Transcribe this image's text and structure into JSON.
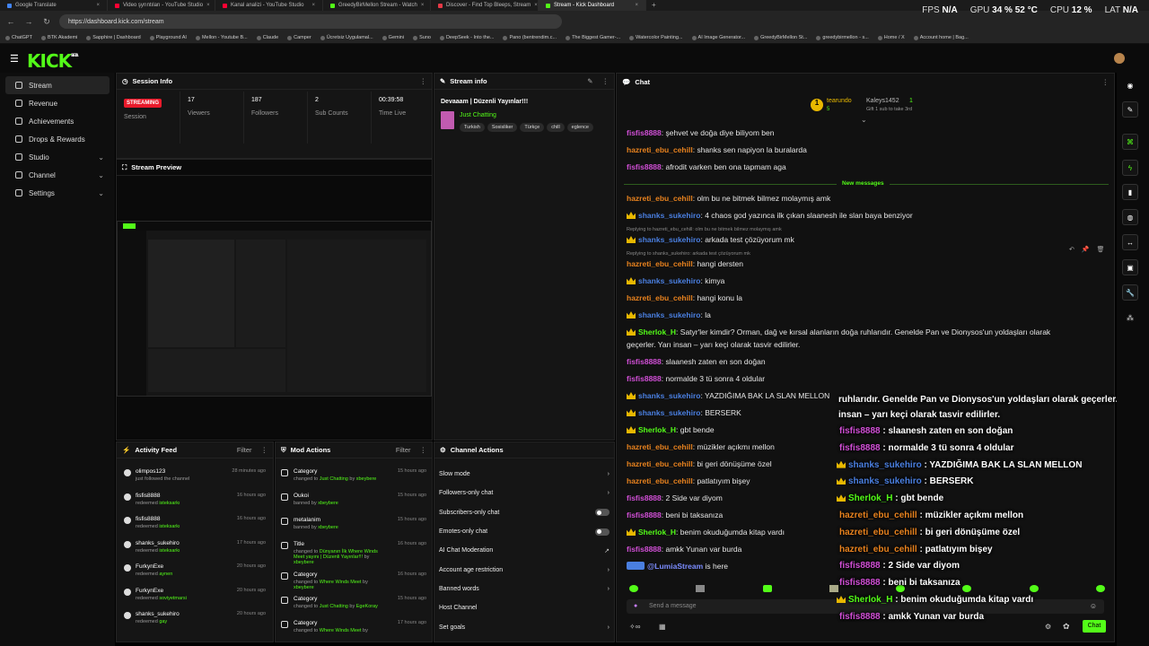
{
  "tabs": [
    {
      "label": "Google Translate",
      "color": "#4285f4"
    },
    {
      "label": "Video şyrıntıları - YouTube Studio",
      "color": "#ff0033"
    },
    {
      "label": "Kanal analizi - YouTube Studio",
      "color": "#ff0033"
    },
    {
      "label": "GreedyBirMellon Stream - Watch",
      "color": "#53fc18"
    },
    {
      "label": "Discover - Find Top Bleeps, Stream",
      "color": "#e63946"
    },
    {
      "label": "Stream - Kick Dashboard",
      "color": "#53fc18"
    }
  ],
  "new_tab": "+",
  "url": "https://dashboard.kick.com/stream",
  "hud": {
    "fps_label": "FPS",
    "fps": "N/A",
    "gpu_label": "GPU",
    "gpu": "34 % 52 °C",
    "cpu_label": "CPU",
    "cpu": "12 %",
    "lat_label": "LAT",
    "lat": "N/A"
  },
  "bookmarks": [
    "ChatGPT",
    "BTK Akademi",
    "Sapphire | Dashboard",
    "Playground AI",
    "Mellon - Youtube B...",
    "Claude",
    "Camper",
    "Ücretsiz Uygulamal...",
    "Gemini",
    "Suno",
    "DeepSeek - Into the...",
    "Pano (bentrendim.c...",
    "The Biggest Gamer-...",
    "Watercolor Painting...",
    "AI Image Generator...",
    "GreedyBirMellon St...",
    "greedybirmellon - s...",
    "Home / X",
    "Account home | Bag..."
  ],
  "logo": "KICK",
  "logo_sup": "BETA",
  "sidebar": [
    {
      "label": "Stream"
    },
    {
      "label": "Revenue"
    },
    {
      "label": "Achievements"
    },
    {
      "label": "Drops & Rewards"
    },
    {
      "label": "Studio"
    },
    {
      "label": "Channel"
    },
    {
      "label": "Settings"
    }
  ],
  "session": {
    "title": "Session Info",
    "status": "STREAMING",
    "status_label": "Session",
    "viewers": "17",
    "viewers_label": "Viewers",
    "followers": "187",
    "followers_label": "Followers",
    "subs": "2",
    "subs_label": "Sub Counts",
    "time": "00:39:58",
    "time_label": "Time Live"
  },
  "stream_info": {
    "title": "Stream info",
    "stream_title": "Devaaam | Düzenli Yayınlar!!!",
    "category": "Just Chatting",
    "tags": [
      "Turkish",
      "Sosisliker",
      "Türkçe",
      "chill",
      "eglence"
    ]
  },
  "preview": {
    "title": "Stream Preview"
  },
  "activity": {
    "title": "Activity Feed",
    "filter": "Filter",
    "items": [
      {
        "user": "olimpos123",
        "detail": "just followed the channel",
        "reward": "",
        "time": "28 minutes ago"
      },
      {
        "user": "fisfis8888",
        "detail": "redeemed",
        "reward": "isteksarkı",
        "time": "16 hours ago"
      },
      {
        "user": "fisfis8888",
        "detail": "redeemed",
        "reward": "isteksarkı",
        "time": "16 hours ago"
      },
      {
        "user": "shanks_sukehiro",
        "detail": "redeemed",
        "reward": "isteksarkı",
        "time": "17 hours ago"
      },
      {
        "user": "FurkynExe",
        "detail": "redeemed",
        "reward": "aynen",
        "time": "20 hours ago"
      },
      {
        "user": "FurkynExe",
        "detail": "redeemed",
        "reward": "soviyetmarsi",
        "time": "20 hours ago"
      },
      {
        "user": "shanks_sukehiro",
        "detail": "redeemed",
        "reward": "gay",
        "time": "20 hours ago"
      }
    ]
  },
  "mod": {
    "title": "Mod Actions",
    "filter": "Filter",
    "items": [
      {
        "title": "Category",
        "line": "changed to",
        "value": "Just Chatting",
        "by": "by",
        "mod": "xbeybere",
        "time": "15 hours ago"
      },
      {
        "title": "Oukoi",
        "line": "banned by",
        "value": "",
        "by": "",
        "mod": "xbeybere",
        "time": "15 hours ago"
      },
      {
        "title": "metalanim",
        "line": "banned by",
        "value": "",
        "by": "",
        "mod": "xbeybere",
        "time": "15 hours ago"
      },
      {
        "title": "Title",
        "line": "changed to",
        "value": "Dünyanın İlk Where Winds Meet yayını | Düzenli Yayınlar!!!",
        "by": "by",
        "mod": "xbeybere",
        "time": "16 hours ago"
      },
      {
        "title": "Category",
        "line": "changed to",
        "value": "Where Winds Meet",
        "by": "by",
        "mod": "xbeybere",
        "time": "16 hours ago"
      },
      {
        "title": "Category",
        "line": "changed to",
        "value": "Just Chatting",
        "by": "by",
        "mod": "EgeKoray",
        "time": "15 hours ago"
      },
      {
        "title": "Category",
        "line": "changed to",
        "value": "Where Winds Meet",
        "by": "by",
        "mod": "",
        "time": "17 hours ago"
      }
    ]
  },
  "channel_actions": {
    "title": "Channel Actions",
    "items": [
      {
        "label": "Slow mode",
        "ctl": "›"
      },
      {
        "label": "Followers-only chat",
        "ctl": "›"
      },
      {
        "label": "Subscribers-only chat",
        "ctl": "toggle"
      },
      {
        "label": "Emotes-only chat",
        "ctl": "toggle"
      },
      {
        "label": "AI Chat Moderation",
        "ctl": "↗"
      },
      {
        "label": "Account age restriction",
        "ctl": "›"
      },
      {
        "label": "Banned words",
        "ctl": "›"
      },
      {
        "label": "Host Channel",
        "ctl": ""
      },
      {
        "label": "Set goals",
        "ctl": "›"
      }
    ]
  },
  "chat": {
    "title": "Chat",
    "pinned": {
      "user": "tearundo",
      "level": "5",
      "gifter": "Kaleys1452",
      "count": "1",
      "note": "Gift 1 sub to take 3rd"
    },
    "new_messages": "New messages",
    "placeholder": "Send a message",
    "send": "Chat",
    "messages": [
      {
        "user": "fisfis8888",
        "color": "#d14fd6",
        "text": "şehvet ve doğa diye biliyom ben",
        "crown": false
      },
      {
        "user": "hazreti_ebu_cehill",
        "color": "#e8821e",
        "text": "shanks sen napiyon la buralarda",
        "crown": false
      },
      {
        "user": "fisfis8888",
        "color": "#d14fd6",
        "text": "afrodit varken ben ona tapmam aga",
        "crown": false
      },
      {
        "user": "hazreti_ebu_cehill",
        "color": "#e8821e",
        "text": "olm bu ne bitmek bilmez molaymış amk",
        "crown": false
      },
      {
        "user": "shanks_sukehiro",
        "color": "#4a7fe0",
        "text": "4 chaos god yazınca ilk çıkan slaanesh ile slan baya benziyor",
        "crown": true
      },
      {
        "user": "shanks_sukehiro",
        "color": "#4a7fe0",
        "text": "arkada test çözüyorum mk",
        "crown": true,
        "reply": "Replying to hazreti_ebu_cehill: olm bu ne bitmek bilmez molaymış amk"
      },
      {
        "user": "hazreti_ebu_cehill",
        "color": "#e8821e",
        "text": "hangi dersten",
        "crown": false,
        "reply": "Replying to shanks_sukehiro: arkada test çözüyorum mk"
      },
      {
        "user": "shanks_sukehiro",
        "color": "#4a7fe0",
        "text": "kimya",
        "crown": true
      },
      {
        "user": "hazreti_ebu_cehill",
        "color": "#e8821e",
        "text": "hangi konu la",
        "crown": false
      },
      {
        "user": "shanks_sukehiro",
        "color": "#4a7fe0",
        "text": "la",
        "crown": true
      },
      {
        "user": "Sherlok_H",
        "color": "#53fc18",
        "text": "Satyr'ler kimdir? Orman, dağ ve kırsal alanların doğa ruhlarıdır. Genelde Pan ve Dionysos'un yoldaşları olarak",
        "text2": "geçerler. Yarı insan – yarı keçi olarak tasvir edilirler.",
        "crown": true
      },
      {
        "user": "fisfis8888",
        "color": "#d14fd6",
        "text": "slaanesh zaten en son doğan",
        "crown": false
      },
      {
        "user": "fisfis8888",
        "color": "#d14fd6",
        "text": "normalde 3 tü sonra 4 oldular",
        "crown": false
      },
      {
        "user": "shanks_sukehiro",
        "color": "#4a7fe0",
        "text": "YAZDIĞIMA BAK LA SLAN MELLON",
        "crown": true
      },
      {
        "user": "shanks_sukehiro",
        "color": "#4a7fe0",
        "text": "BERSERK",
        "crown": true
      },
      {
        "user": "Sherlok_H",
        "color": "#53fc18",
        "text": "gbt bende",
        "crown": true
      },
      {
        "user": "hazreti_ebu_cehill",
        "color": "#e8821e",
        "text": "müzikler açıkmı mellon",
        "crown": false
      },
      {
        "user": "hazreti_ebu_cehill",
        "color": "#e8821e",
        "text": "bi geri dönüşüme özel",
        "crown": false
      },
      {
        "user": "hazreti_ebu_cehill",
        "color": "#e8821e",
        "text": "patlatıyım bişey",
        "crown": false
      },
      {
        "user": "fisfis8888",
        "color": "#d14fd6",
        "text": "2 Side var diyom",
        "crown": false
      },
      {
        "user": "fisfis8888",
        "color": "#d14fd6",
        "text": "beni bi taksanıza",
        "crown": false
      },
      {
        "user": "Sherlok_H",
        "color": "#53fc18",
        "text": "benim okuduğumda kitap vardı",
        "crown": true
      },
      {
        "user": "fisfis8888",
        "color": "#d14fd6",
        "text": "amkk Yunan var burda",
        "crown": false
      },
      {
        "user": "@LumiaStream",
        "color": "#7b8cff",
        "text": "is here",
        "crown": false
      }
    ]
  },
  "overlay": {
    "line1": "ruhlarıdır. Genelde Pan ve Dionysos'un yoldaşları olarak geçerler. Yarı",
    "line2": "insan – yarı keçi olarak tasvir edilirler.",
    "lines": [
      {
        "user": "fisfis8888",
        "color": "#d14fd6",
        "text": " : slaanesh zaten en son doğan",
        "crown": false
      },
      {
        "user": "fisfis8888",
        "color": "#d14fd6",
        "text": " : normalde 3 tü sonra 4 oldular",
        "crown": false
      },
      {
        "user": "shanks_sukehiro",
        "color": "#4a7fe0",
        "text": " : YAZDIĞIMA BAK LA SLAN MELLON",
        "crown": true
      },
      {
        "user": "shanks_sukehiro",
        "color": "#4a7fe0",
        "text": " : BERSERK",
        "crown": true
      },
      {
        "user": "Sherlok_H",
        "color": "#53fc18",
        "text": " : gbt bende",
        "crown": true
      },
      {
        "user": "hazreti_ebu_cehill",
        "color": "#e8821e",
        "text": " : müzikler açıkmı mellon",
        "crown": false
      },
      {
        "user": "hazreti_ebu_cehill",
        "color": "#e8821e",
        "text": " : bi geri dönüşüme özel",
        "crown": false
      },
      {
        "user": "hazreti_ebu_cehill",
        "color": "#e8821e",
        "text": " : patlatıyım bişey",
        "crown": false
      },
      {
        "user": "fisfis8888",
        "color": "#d14fd6",
        "text": " : 2 Side var diyom",
        "crown": false
      },
      {
        "user": "fisfis8888",
        "color": "#d14fd6",
        "text": " : beni bi taksanıza",
        "crown": false
      },
      {
        "user": "Sherlok_H",
        "color": "#53fc18",
        "text": " : benim okuduğumda kitap vardı",
        "crown": true
      },
      {
        "user": "fisfis8888",
        "color": "#d14fd6",
        "text": " : amkk Yunan var burda",
        "crown": false
      }
    ]
  },
  "colors": {
    "brand": "#53fc18",
    "streaming": "#e91a2b",
    "panel": "#151515"
  }
}
